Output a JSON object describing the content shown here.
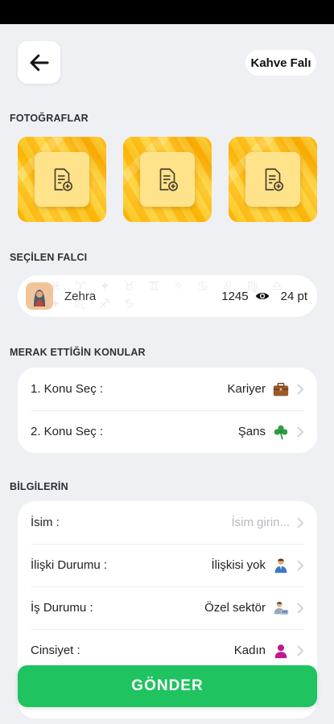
{
  "header": {
    "back_icon": "arrow-left-icon",
    "title": "Kahve Falı"
  },
  "sections": {
    "photos": "FOTOĞRAFLAR",
    "selected_teller": "SEÇİLEN FALCI",
    "topics": "MERAK ETTİĞİN KONULAR",
    "info": "BİLGİLERİN"
  },
  "photos": [
    {
      "icon": "add-document-icon"
    },
    {
      "icon": "add-document-icon"
    },
    {
      "icon": "add-document-icon"
    }
  ],
  "teller": {
    "name": "Zehra",
    "views": "1245",
    "price": "24 pt"
  },
  "topics": [
    {
      "label": "1. Konu Seç :",
      "value": "Kariyer",
      "icon": "briefcase-icon"
    },
    {
      "label": "2. Konu Seç :",
      "value": "Şans",
      "icon": "clover-icon"
    }
  ],
  "info": {
    "name": {
      "label": "İsim :",
      "placeholder": "İsim girin..."
    },
    "relationship": {
      "label": "İlişki Durumu :",
      "value": "İlişkisi yok",
      "icon": "person-icon"
    },
    "job": {
      "label": "İş Durumu :",
      "value": "Özel sektör",
      "icon": "office-worker-icon"
    },
    "gender": {
      "label": "Cinsiyet :",
      "value": "Kadın",
      "icon": "woman-icon"
    }
  },
  "submit_label": "GÖNDER",
  "colors": {
    "accent_green": "#1fc35f",
    "photo_yellow": "#ffd23f",
    "background": "#eef0f4"
  }
}
